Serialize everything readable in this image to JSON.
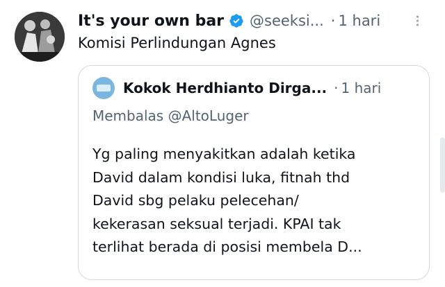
{
  "tweet": {
    "display_name": "It's your own bar",
    "handle": "@seeksi...",
    "separator": "·",
    "time": "1 hari",
    "text": "Komisi Perlindungan Agnes"
  },
  "quoted_tweet": {
    "display_name": "Kokok Herdhianto Dirga...",
    "separator": "·",
    "time": "1 hari",
    "reply_to": "Membalas @AltoLuger",
    "body_lines": [
      "Yg paling menyakitkan adalah ketika",
      "David dalam kondisi luka, fitnah thd",
      "David sbg pelaku pelecehan/",
      "kekerasan seksual terjadi. KPAI tak",
      "terlihat berada di posisi membela D..."
    ]
  },
  "icons": {
    "verified": "verified-badge-icon",
    "more": "more-vertical-icon"
  },
  "colors": {
    "primary_text": "#0f1419",
    "secondary_text": "#536471",
    "verified_blue": "#1d9bf0",
    "border": "#cfd9de"
  }
}
